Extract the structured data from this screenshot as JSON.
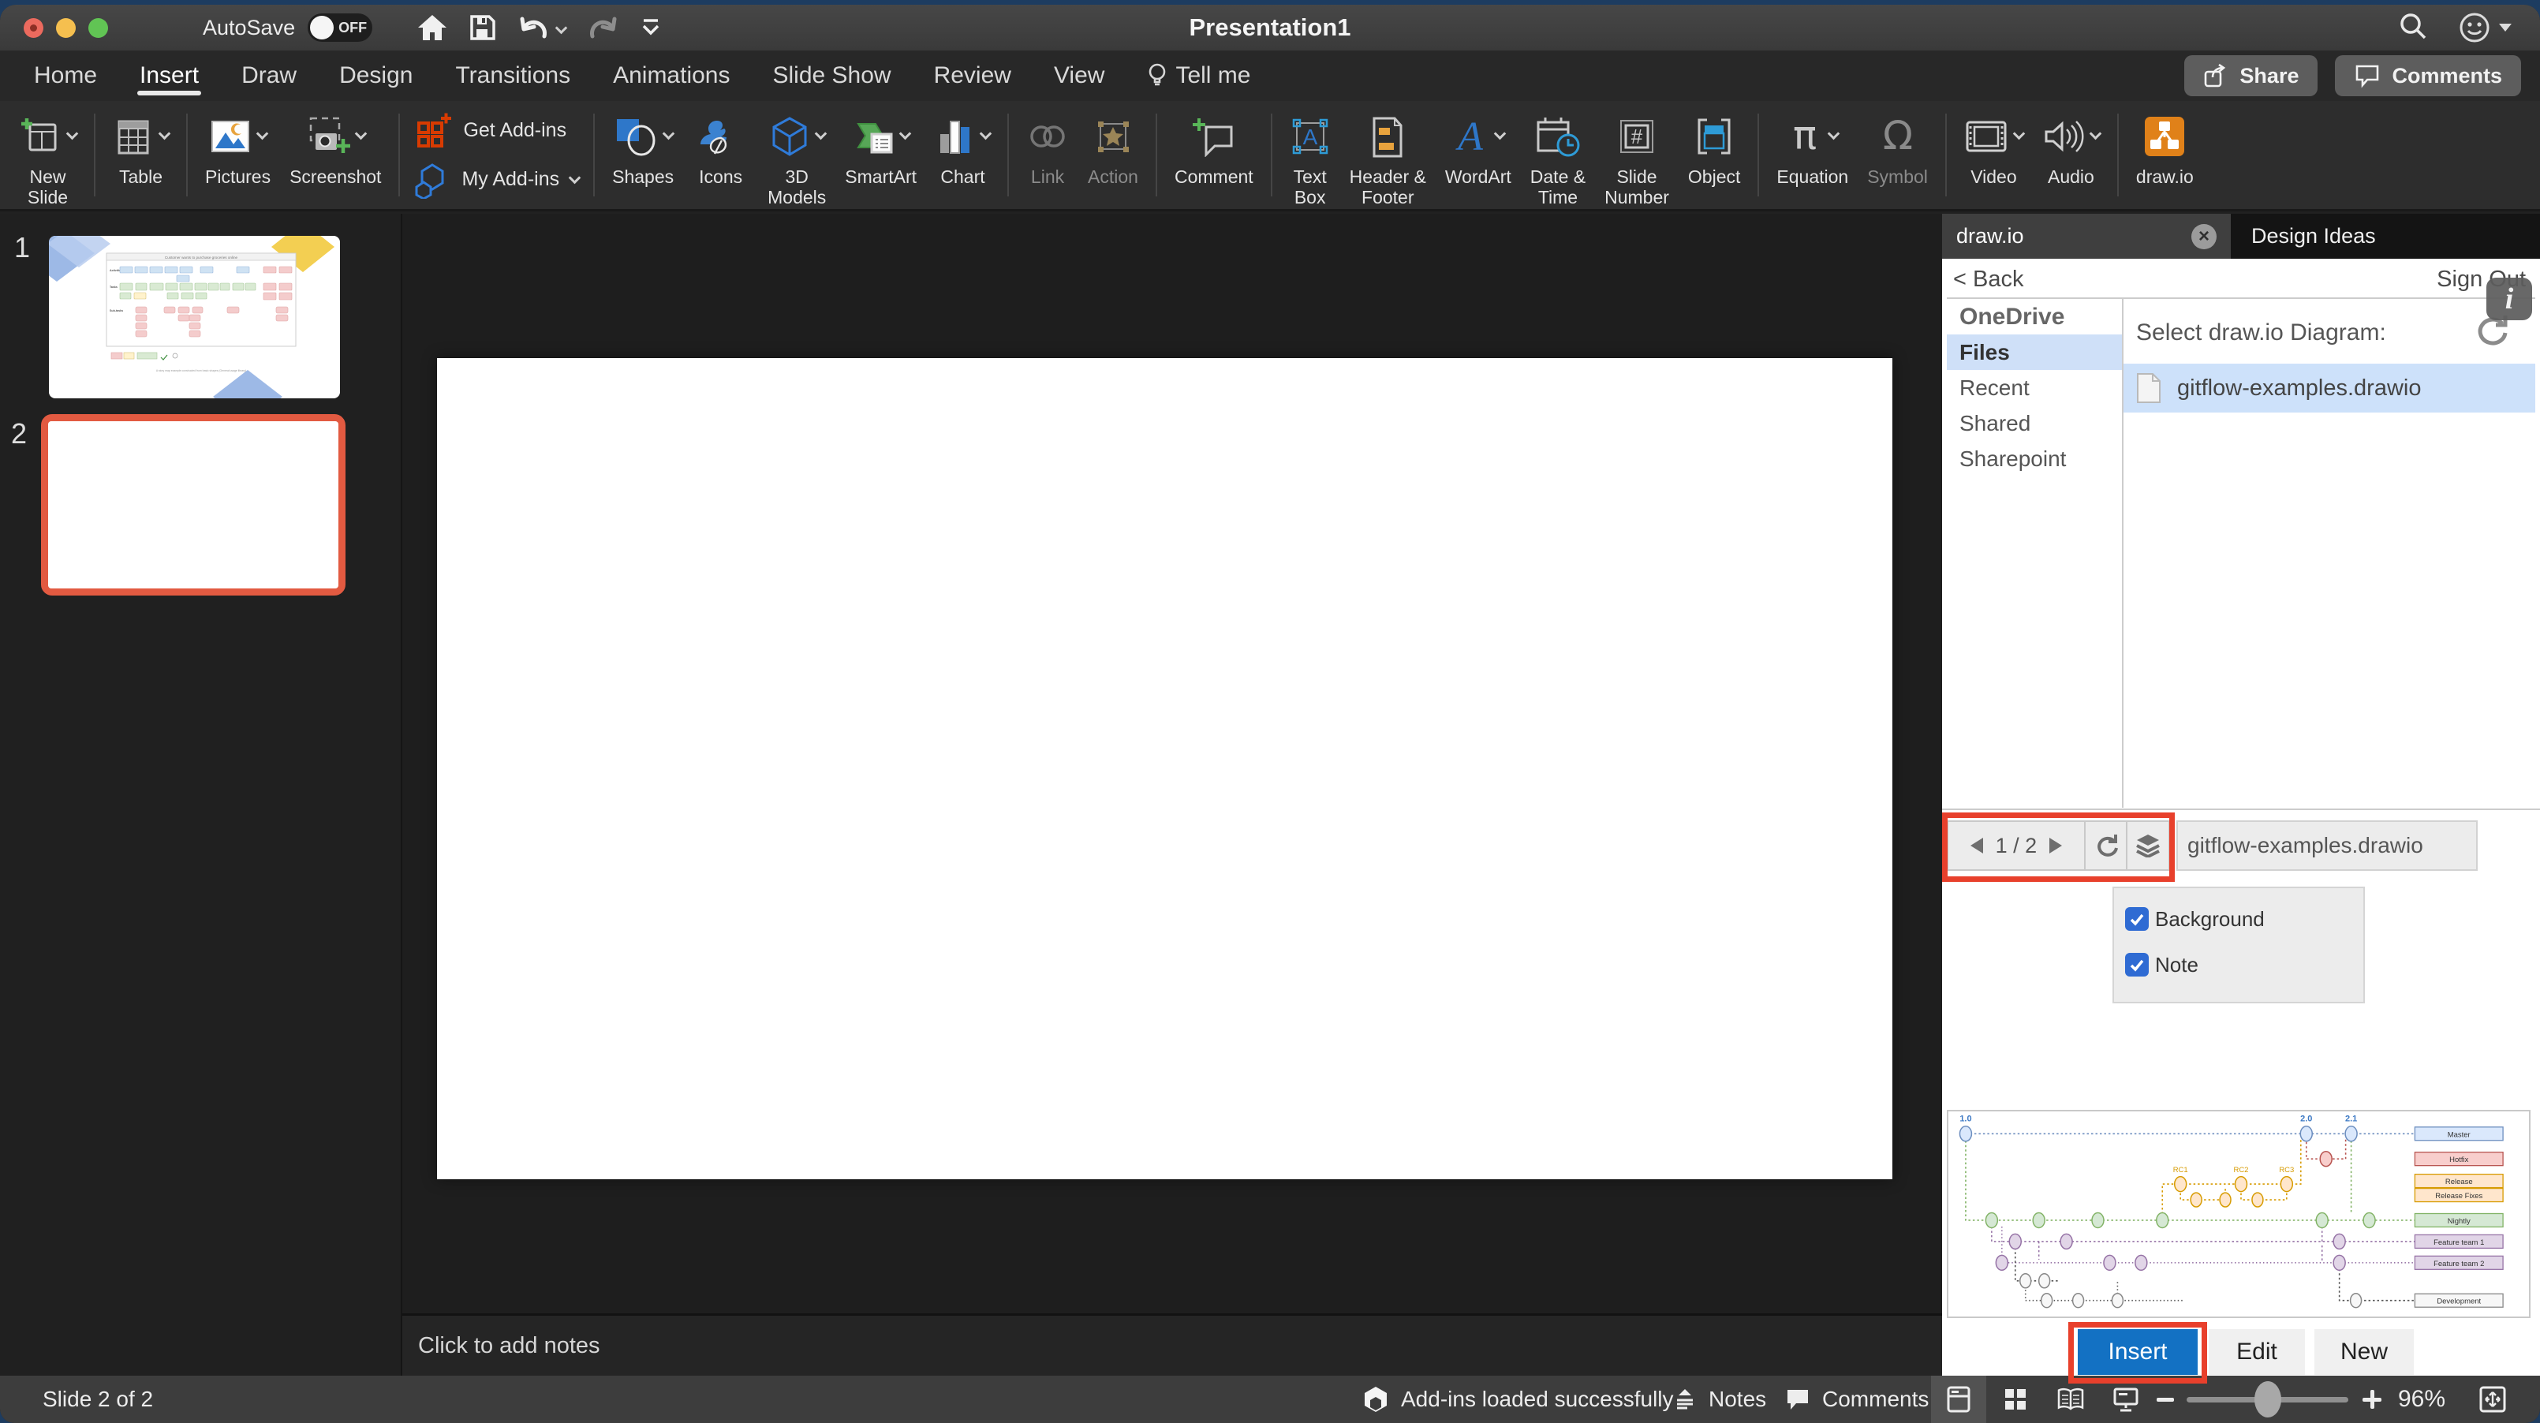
{
  "titlebar": {
    "autosave_label": "AutoSave",
    "autosave_state": "OFF",
    "title": "Presentation1"
  },
  "tabs": {
    "items": [
      "Home",
      "Insert",
      "Draw",
      "Design",
      "Transitions",
      "Animations",
      "Slide Show",
      "Review",
      "View",
      "Tell me"
    ],
    "active": "Insert",
    "share": "Share",
    "comments": "Comments"
  },
  "ribbon": {
    "new_slide": "New\nSlide",
    "table": "Table",
    "pictures": "Pictures",
    "screenshot": "Screenshot",
    "get_addins": "Get Add-ins",
    "my_addins": "My Add-ins",
    "shapes": "Shapes",
    "icons": "Icons",
    "models_3d": "3D\nModels",
    "smartart": "SmartArt",
    "chart": "Chart",
    "link": "Link",
    "action": "Action",
    "comment": "Comment",
    "text_box": "Text\nBox",
    "header_footer": "Header &\nFooter",
    "wordart": "WordArt",
    "date_time": "Date &\nTime",
    "slide_number": "Slide\nNumber",
    "object": "Object",
    "equation": "Equation",
    "symbol": "Symbol",
    "video": "Video",
    "audio": "Audio",
    "drawio": "draw.io"
  },
  "slides": {
    "s1_number": "1",
    "s2_number": "2",
    "s1_title": "Customer wants to purchase groceries online",
    "s1_caption": "A story map example constructed from basic shapes (General usage library)"
  },
  "notes": {
    "placeholder": "Click to add notes"
  },
  "panel": {
    "tab_drawio": "draw.io",
    "tab_design": "Design Ideas",
    "back": "< Back",
    "sign_out": "Sign Out",
    "info": "i",
    "sidebar": [
      "OneDrive",
      "Files",
      "Recent",
      "Shared",
      "Sharepoint"
    ],
    "selected_item": "Files",
    "select_label": "Select draw.io Diagram:",
    "file_name": "gitflow-examples.drawio",
    "page_indicator": "1 / 2",
    "filename_value": "gitflow-examples.drawio",
    "checkbox_background": "Background",
    "checkbox_note": "Note",
    "insert": "Insert",
    "edit": "Edit",
    "new": "New"
  },
  "preview": {
    "tags": {
      "v1": "1.0",
      "v2": "2.0",
      "v21": "2.1",
      "rc1": "RC1",
      "rc2": "RC2",
      "rc3": "RC3"
    },
    "branches": {
      "master": "Master",
      "hotfix": "Hotfix",
      "release": "Release",
      "release_fixes": "Release Fixes",
      "nightly": "Nightly",
      "ft1": "Feature team 1",
      "ft2": "Feature team 2",
      "dev": "Development"
    },
    "colors": {
      "blue": "#6c8ebf",
      "red": "#b85450",
      "orange": "#d79b00",
      "green": "#82b366",
      "purple": "#9673a6",
      "gray": "#888888"
    }
  },
  "status": {
    "slide": "Slide 2 of 2",
    "addins": "Add-ins loaded successfully",
    "notes": "Notes",
    "comments": "Comments",
    "zoom": "96%"
  }
}
